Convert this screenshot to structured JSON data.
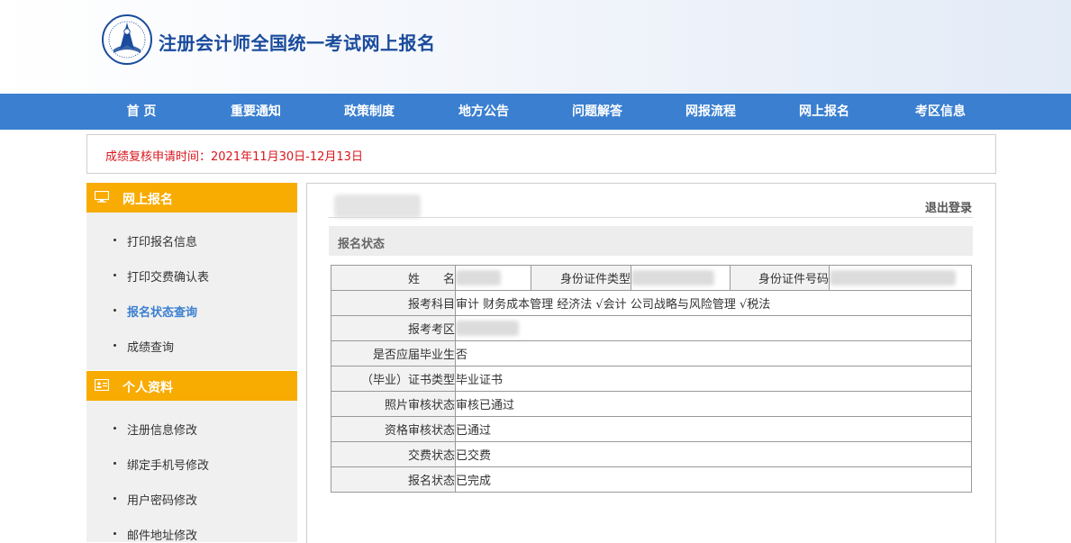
{
  "header": {
    "title": "注册会计师全国统一考试网上报名"
  },
  "nav": {
    "items": [
      "首 页",
      "重要通知",
      "政策制度",
      "地方公告",
      "问题解答",
      "网报流程",
      "网上报名",
      "考区信息"
    ]
  },
  "notice": {
    "text": "成绩复核申请时间：2021年11月30日-12月13日"
  },
  "sidebar": {
    "sections": [
      {
        "title": "网上报名",
        "icon": "monitor-icon",
        "items": [
          "打印报名信息",
          "打印交费确认表",
          "报名状态查询",
          "成绩查询"
        ],
        "active_index": 2
      },
      {
        "title": "个人资料",
        "icon": "id-card-icon",
        "items": [
          "注册信息修改",
          "绑定手机号修改",
          "用户密码修改",
          "邮件地址修改"
        ]
      }
    ]
  },
  "main": {
    "logout": "退出登录",
    "section_title": "报名状态",
    "table": {
      "name_label": "姓　　名",
      "id_type_label": "身份证件类型",
      "id_number_label": "身份证件号码",
      "rows": [
        {
          "label": "报考科目",
          "value": "审计  财务成本管理  经济法  √会计  公司战略与风险管理  √税法"
        },
        {
          "label": "报考考区",
          "value": ""
        },
        {
          "label": "是否应届毕业生",
          "value": "否"
        },
        {
          "label": "（毕业）证书类型",
          "value": "毕业证书"
        },
        {
          "label": "照片审核状态",
          "value": "审核已通过"
        },
        {
          "label": "资格审核状态",
          "value": "已通过"
        },
        {
          "label": "交费状态",
          "value": "已交费"
        },
        {
          "label": "报名状态",
          "value": "已完成"
        }
      ]
    }
  },
  "colors": {
    "nav_bg": "#3a7fd0",
    "sidebar_head": "#f8ab00",
    "notice_text": "#d9171e",
    "title": "#1a4b9c"
  }
}
